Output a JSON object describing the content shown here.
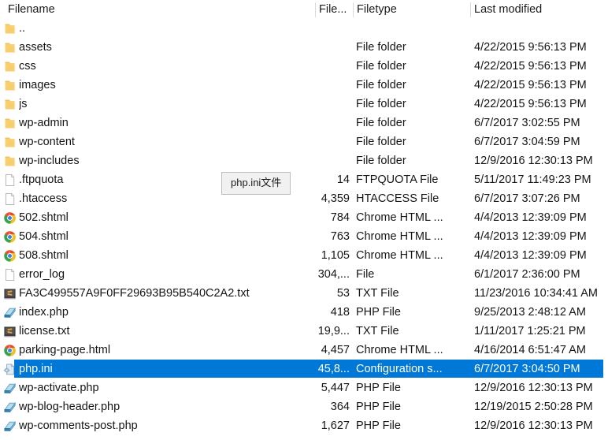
{
  "header": {
    "columns": [
      {
        "key": "name",
        "label": "Filename"
      },
      {
        "key": "size",
        "label": "File..."
      },
      {
        "key": "type",
        "label": "Filetype"
      },
      {
        "key": "modified",
        "label": "Last modified"
      }
    ]
  },
  "tooltip": {
    "text": "php.ini文件"
  },
  "colors": {
    "selection": "#0078d7",
    "selection_text": "#ffffff",
    "background": "#ffffff",
    "text": "#151515",
    "header_separator": "#dadada",
    "tooltip_background": "#f1f1f1",
    "tooltip_border": "#bdbdbd",
    "folder_icon": "#f5cc6a"
  },
  "rows": [
    {
      "icon": "folder-icon",
      "name": "..",
      "size": "",
      "type": "",
      "modified": "",
      "selected": false
    },
    {
      "icon": "folder-icon",
      "name": "assets",
      "size": "",
      "type": "File folder",
      "modified": "4/22/2015 9:56:13 PM",
      "selected": false
    },
    {
      "icon": "folder-icon",
      "name": "css",
      "size": "",
      "type": "File folder",
      "modified": "4/22/2015 9:56:13 PM",
      "selected": false
    },
    {
      "icon": "folder-icon",
      "name": "images",
      "size": "",
      "type": "File folder",
      "modified": "4/22/2015 9:56:13 PM",
      "selected": false
    },
    {
      "icon": "folder-icon",
      "name": "js",
      "size": "",
      "type": "File folder",
      "modified": "4/22/2015 9:56:13 PM",
      "selected": false
    },
    {
      "icon": "folder-icon",
      "name": "wp-admin",
      "size": "",
      "type": "File folder",
      "modified": "6/7/2017 3:02:55 PM",
      "selected": false
    },
    {
      "icon": "folder-icon",
      "name": "wp-content",
      "size": "",
      "type": "File folder",
      "modified": "6/7/2017 3:04:59 PM",
      "selected": false
    },
    {
      "icon": "folder-icon",
      "name": "wp-includes",
      "size": "",
      "type": "File folder",
      "modified": "12/9/2016 12:30:13 PM",
      "selected": false
    },
    {
      "icon": "blank-file-icon",
      "name": ".ftpquota",
      "size": "14",
      "type": "FTPQUOTA File",
      "modified": "5/11/2017 11:49:23 PM",
      "selected": false
    },
    {
      "icon": "blank-file-icon",
      "name": ".htaccess",
      "size": "4,359",
      "type": "HTACCESS File",
      "modified": "6/7/2017 3:07:26 PM",
      "selected": false
    },
    {
      "icon": "chrome-icon",
      "name": "502.shtml",
      "size": "784",
      "type": "Chrome HTML ...",
      "modified": "4/4/2013 12:39:09 PM",
      "selected": false
    },
    {
      "icon": "chrome-icon",
      "name": "504.shtml",
      "size": "763",
      "type": "Chrome HTML ...",
      "modified": "4/4/2013 12:39:09 PM",
      "selected": false
    },
    {
      "icon": "chrome-icon",
      "name": "508.shtml",
      "size": "1,105",
      "type": "Chrome HTML ...",
      "modified": "4/4/2013 12:39:09 PM",
      "selected": false
    },
    {
      "icon": "blank-file-icon",
      "name": "error_log",
      "size": "304,...",
      "type": "File",
      "modified": "6/1/2017 2:36:00 PM",
      "selected": false
    },
    {
      "icon": "sublime-text-icon",
      "name": "FA3C499557A9F0FF29693B95B540C2A2.txt",
      "size": "53",
      "type": "TXT File",
      "modified": "11/23/2016 10:34:41 AM",
      "selected": false
    },
    {
      "icon": "php-file-icon",
      "name": "index.php",
      "size": "418",
      "type": "PHP File",
      "modified": "9/25/2013 2:48:12 AM",
      "selected": false
    },
    {
      "icon": "sublime-text-icon",
      "name": "license.txt",
      "size": "19,9...",
      "type": "TXT File",
      "modified": "1/11/2017 1:25:21 PM",
      "selected": false
    },
    {
      "icon": "chrome-icon",
      "name": "parking-page.html",
      "size": "4,457",
      "type": "Chrome HTML ...",
      "modified": "4/16/2014 6:51:47 AM",
      "selected": false
    },
    {
      "icon": "ini-file-icon",
      "name": "php.ini",
      "size": "45,8...",
      "type": "Configuration s...",
      "modified": "6/7/2017 3:04:50 PM",
      "selected": true
    },
    {
      "icon": "php-file-icon",
      "name": "wp-activate.php",
      "size": "5,447",
      "type": "PHP File",
      "modified": "12/9/2016 12:30:13 PM",
      "selected": false
    },
    {
      "icon": "php-file-icon",
      "name": "wp-blog-header.php",
      "size": "364",
      "type": "PHP File",
      "modified": "12/19/2015 2:50:28 PM",
      "selected": false
    },
    {
      "icon": "php-file-icon",
      "name": "wp-comments-post.php",
      "size": "1,627",
      "type": "PHP File",
      "modified": "12/9/2016 12:30:13 PM",
      "selected": false
    }
  ]
}
